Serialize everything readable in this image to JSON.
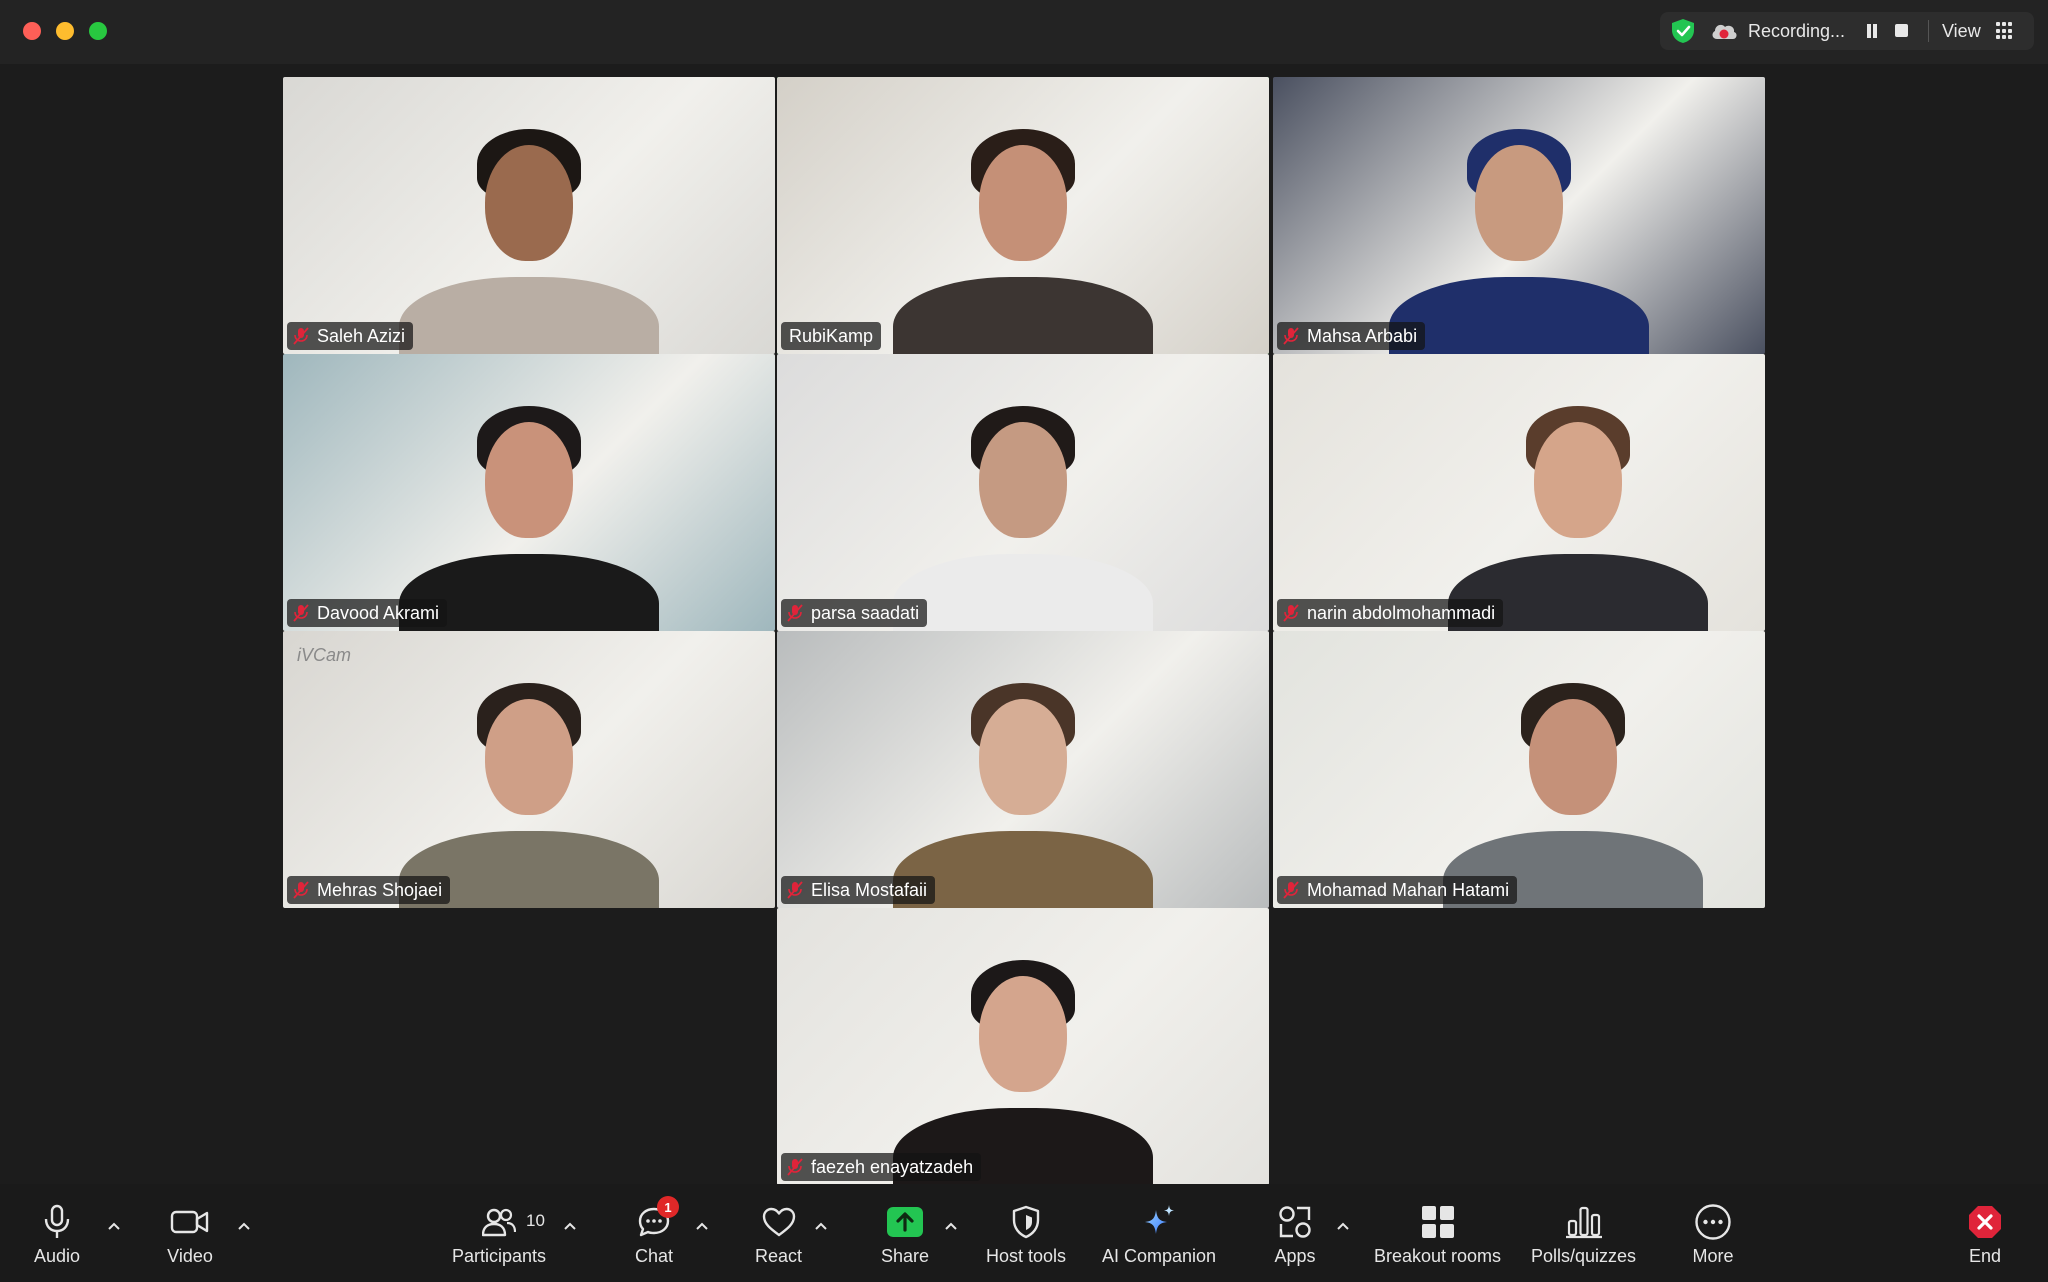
{
  "titlebar": {
    "recording_label": "Recording...",
    "view_label": "View"
  },
  "participants": [
    {
      "name": "Saleh Azizi",
      "muted": true,
      "active": false,
      "bg": "#d9d8d4",
      "skin": "#9a6a4e",
      "hair": "#1c1714",
      "shirt": "#b9aea4"
    },
    {
      "name": "RubiKamp",
      "muted": false,
      "active": true,
      "bg": "#d4d0c8",
      "skin": "#c59077",
      "hair": "#2a1e18",
      "shirt": "#3c3532"
    },
    {
      "name": "Mahsa Arbabi",
      "muted": true,
      "active": false,
      "bg": "#4a5060",
      "skin": "#c89a7f",
      "hair": "#1f2f6a",
      "shirt": "#1f2f6a"
    },
    {
      "name": "Davood Akrami",
      "muted": true,
      "active": false,
      "bg": "#9fb7bd",
      "skin": "#c9927a",
      "hair": "#1d1919",
      "shirt": "#1a1a1a"
    },
    {
      "name": "parsa saadati",
      "muted": true,
      "active": false,
      "bg": "#dcdcdc",
      "skin": "#c59a82",
      "hair": "#201a18",
      "shirt": "#ebebeb"
    },
    {
      "name": "narin abdolmohammadi",
      "muted": true,
      "active": false,
      "bg": "#e4e2dc",
      "skin": "#d5a58a",
      "hair": "#5a3d2c",
      "shirt": "#2b2b30"
    },
    {
      "name": "Mehras Shojaei",
      "muted": true,
      "active": false,
      "bg": "#d8d6d1",
      "skin": "#cf9f87",
      "hair": "#2a211c",
      "shirt": "#7a7566"
    },
    {
      "name": "Elisa Mostafaii",
      "muted": true,
      "active": false,
      "bg": "#b9bcbd",
      "skin": "#d6ad95",
      "hair": "#4a3528",
      "shirt": "#7b6445"
    },
    {
      "name": "Mohamad Mahan Hatami",
      "muted": true,
      "active": false,
      "bg": "#e2e3de",
      "skin": "#c59179",
      "hair": "#2b221c",
      "shirt": "#6f7478"
    },
    {
      "name": "faezeh enayatzadeh",
      "muted": true,
      "active": false,
      "bg": "#e3e2de",
      "skin": "#d4a58d",
      "hair": "#1c1818",
      "shirt": "#1c1818"
    }
  ],
  "watermark": "iVCam",
  "toolbar": {
    "audio": "Audio",
    "video": "Video",
    "participants": "Participants",
    "participants_count": "10",
    "chat": "Chat",
    "chat_badge": "1",
    "react": "React",
    "share": "Share",
    "host_tools": "Host tools",
    "ai_companion": "AI Companion",
    "apps": "Apps",
    "breakout_rooms": "Breakout rooms",
    "polls": "Polls/quizzes",
    "more": "More",
    "end": "End"
  },
  "colors": {
    "active_speaker": "#23c552",
    "share_green": "#23c552",
    "end_red": "#e0243a",
    "badge_red": "#e02828"
  }
}
